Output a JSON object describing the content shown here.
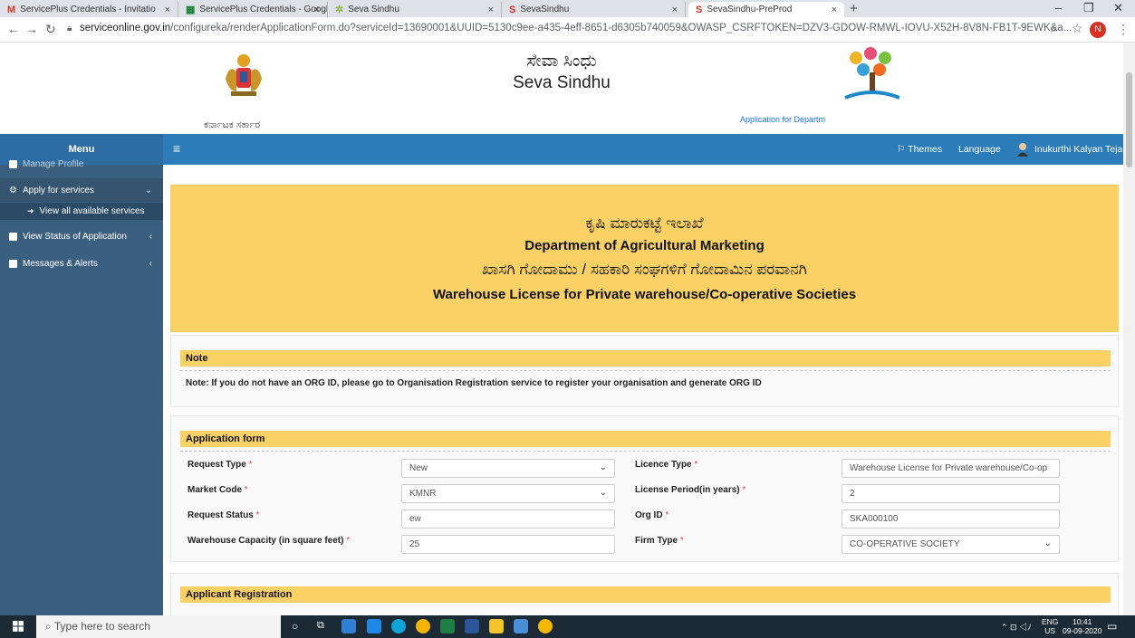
{
  "browser": {
    "tabs": [
      {
        "title": "ServicePlus Credentials - Invitatio",
        "icon": "gmail-icon"
      },
      {
        "title": "ServicePlus Credentials - Google",
        "icon": "sheets-icon"
      },
      {
        "title": "Seva Sindhu",
        "icon": "sevasindhu-icon"
      },
      {
        "title": "SevaSindhu",
        "icon": "sevasindhu-s-icon"
      },
      {
        "title": "SevaSindhu-PreProd",
        "icon": "sevasindhu-s-icon"
      }
    ],
    "url_domain": "serviceonline.gov.in",
    "url_path": "/configureka/renderApplicationForm.do?serviceId=13690001&UUID=5130c9ee-a435-4eff-8651-d6305b740059&OWASP_CSRFTOKEN=DZV3-GDOW-RMWL-IOVU-X52H-8V8N-FB1T-9EWK&a...",
    "profile_initial": "N"
  },
  "header": {
    "emblem_text": "ಕರ್ನಾಟಕ ಸರ್ಕಾರ",
    "title_kn": "ಸೇವಾ ಸಿಂಧು",
    "title_en": "Seva Sindhu",
    "app_for": "Application for Departm"
  },
  "topnav": {
    "menu": "Menu",
    "themes": "Themes",
    "language": "Language",
    "user": "Inukurthi Kalyan Teja"
  },
  "sidebar": {
    "manage_profile": "Manage Profile",
    "apply": "Apply for services",
    "view_all": "View all available services",
    "view_status": "View Status of Application",
    "messages": "Messages & Alerts"
  },
  "banner": {
    "dept_kn": "ಕೃಷಿ ಮಾರುಕಟ್ಟೆ ಇಲಾಖೆ",
    "dept_en": "Department of Agricultural Marketing",
    "license_kn": "ಖಾಸಗಿ ಗೋದಾಮು / ಸಹಕಾರಿ ಸಂಘಗಳಿಗೆ ಗೋದಾಮಿನ ಪರವಾನಗಿ",
    "license_en": "Warehouse License for Private warehouse/Co-operative Societies"
  },
  "note": {
    "heading": "Note",
    "text": "Note: If you do not have an ORG ID, please go to Organisation Registration service to register your organisation and generate ORG ID"
  },
  "application_form": {
    "heading": "Application form",
    "request_type_label": "Request Type",
    "request_type_value": "New",
    "licence_type_label": "Licence Type",
    "licence_type_value": "Warehouse License for Private warehouse/Co-op",
    "market_code_label": "Market Code",
    "market_code_value": "KMNR",
    "license_period_label": "License Period(in years)",
    "license_period_value": "2",
    "request_status_label": "Request Status",
    "request_status_value": "ew",
    "org_id_label": "Org ID",
    "org_id_value": "SKA000100",
    "capacity_label": "Warehouse Capacity (in square feet)",
    "capacity_value": "25",
    "firm_type_label": "Firm Type",
    "firm_type_value": "CO-OPERATIVE SOCIETY"
  },
  "applicant_registration": {
    "heading": "Applicant Registration"
  },
  "taskbar": {
    "search_placeholder": "Type here to search",
    "lang_top": "ENG",
    "lang_bottom": "US",
    "time": "10:41",
    "date": "09-09-2020"
  }
}
